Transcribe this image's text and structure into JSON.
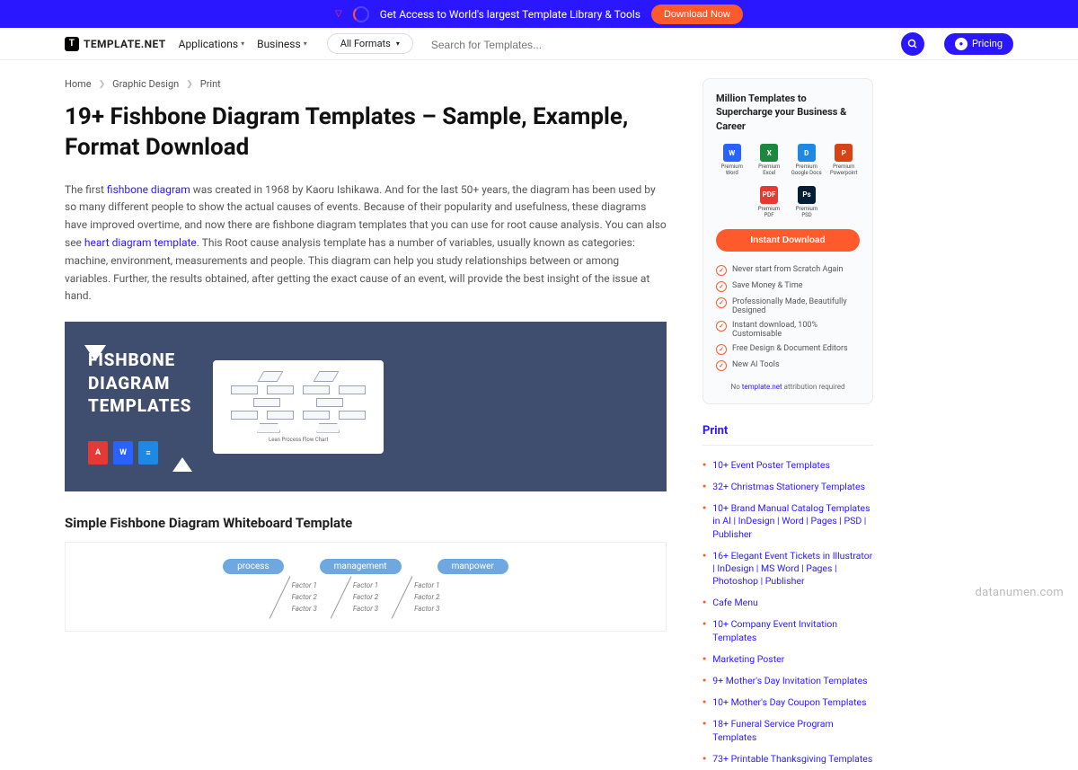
{
  "banner": {
    "text": "Get Access to World's largest Template Library & Tools",
    "cta": "Download Now"
  },
  "brand": "TEMPLATE.NET",
  "nav": {
    "applications": "Applications",
    "business": "Business",
    "formats": "All Formats"
  },
  "search": {
    "placeholder": "Search for Templates..."
  },
  "pricing": "Pricing",
  "breadcrumb": {
    "home": "Home",
    "graphic": "Graphic Design",
    "print": "Print"
  },
  "title": "19+ Fishbone Diagram Templates – Sample, Example, Format Download",
  "intro": {
    "p1a": "The first ",
    "link1": "fishbone diagram",
    "p1b": " was created in 1968 by Kaoru Ishikawa. And for the last 50+ years, the diagram has been used by so many different people to show the actual causes of events. Because of their popularity and usefulness, these diagrams have improved overtime, and now there are fishbone diagram templates that you can use for root cause analysis. You can also see ",
    "link2": "heart diagram template",
    "p1c": ". This Root cause analysis template has a number of variables, usually known as categories: machine, environment, measurements and people. This diagram can help you study relationships between or among variables. Further, the results obtained, after getting the exact cause of an event, will provide the best insight of the issue at hand."
  },
  "hero": {
    "line1": "FISHBONE",
    "line2": "DIAGRAM",
    "line3": "TEMPLATES",
    "card_label": "Lean Process Flow Chart"
  },
  "h2": "Simple Fishbone Diagram Whiteboard Template",
  "wb": {
    "cats": [
      "process",
      "management",
      "manpower"
    ],
    "factors": [
      "Factor 1",
      "Factor 2",
      "Factor 3"
    ]
  },
  "promo": {
    "title": "Million Templates to Supercharge your Business & Career",
    "apps": [
      {
        "label": "Premium Word",
        "color": "#2962ff",
        "t": "W"
      },
      {
        "label": "Premium Excel",
        "color": "#1b873f",
        "t": "X"
      },
      {
        "label": "Premium Google Docs",
        "color": "#1e88e5",
        "t": "D"
      },
      {
        "label": "Premium Powerpoint",
        "color": "#d84315",
        "t": "P"
      }
    ],
    "apps2": [
      {
        "label": "Premium PDF",
        "color": "#e53935",
        "t": "PDF"
      },
      {
        "label": "Premium PSD",
        "color": "#001e36",
        "t": "Ps"
      }
    ],
    "cta": "Instant Download",
    "features": [
      "Never start from Scratch Again",
      "Save Money & Time",
      "Professionally Made, Beautifully Designed",
      "Instant download, 100% Customisable",
      "Free Design & Document Editors",
      "New AI Tools"
    ],
    "attr_pre": "No ",
    "attr_link": "template.net",
    "attr_post": " attribution required"
  },
  "side": {
    "head": "Print",
    "links": [
      "10+ Event Poster Templates",
      "32+ Christmas Stationery Templates",
      "10+ Brand Manual Catalog Templates in AI | InDesign | Word | Pages | PSD | Publisher",
      "16+ Elegant Event Tickets in Illustrator | InDesign | MS Word | Pages | Photoshop | Publisher",
      "Cafe Menu",
      "10+ Company Event Invitation Templates",
      "Marketing Poster",
      "9+ Mother's Day Invitation Templates",
      "10+ Mother's Day Coupon Templates",
      "18+ Funeral Service Program Templates",
      "73+ Printable Thanksgiving Templates"
    ]
  },
  "watermark": "datanumen.com"
}
